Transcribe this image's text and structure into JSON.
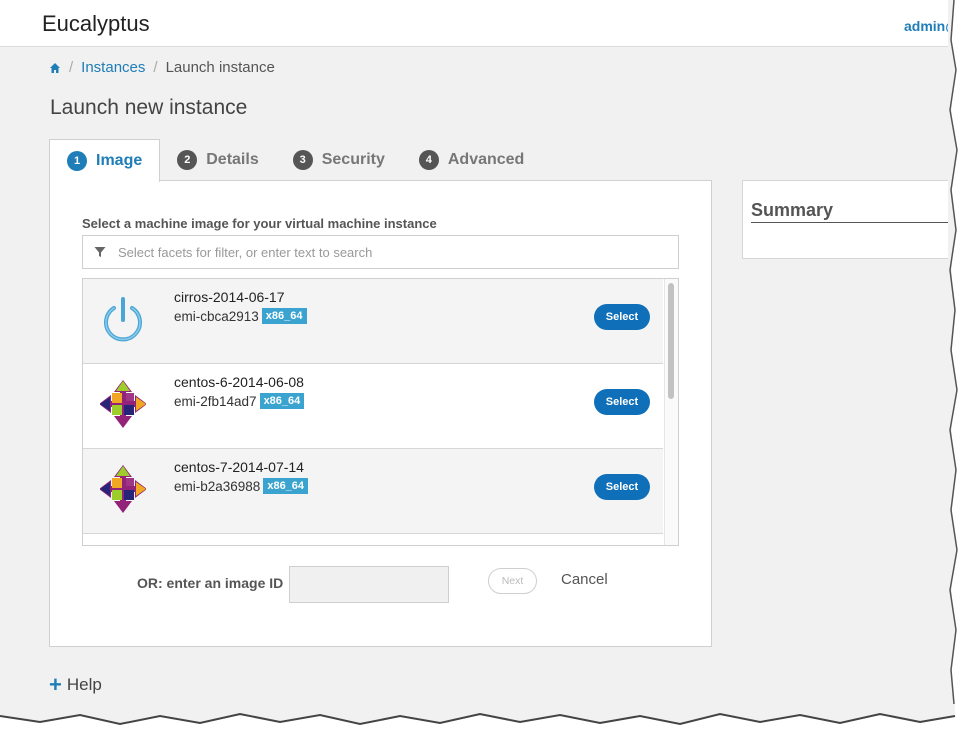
{
  "app": {
    "title": "Eucalyptus",
    "user": "admin@"
  },
  "breadcrumb": {
    "link": "Instances",
    "separator": "/",
    "current": "Launch instance"
  },
  "page": {
    "title": "Launch new instance"
  },
  "tabs": [
    {
      "num": "1",
      "label": "Image",
      "active": true
    },
    {
      "num": "2",
      "label": "Details",
      "active": false
    },
    {
      "num": "3",
      "label": "Security",
      "active": false
    },
    {
      "num": "4",
      "label": "Advanced",
      "active": false
    }
  ],
  "image_step": {
    "instruction": "Select a machine image for your virtual machine instance",
    "search_placeholder": "Select facets for filter, or enter text to search",
    "images": [
      {
        "name": "cirros-2014-06-17",
        "id": "emi-cbca2913",
        "arch": "x86_64",
        "icon": "power-icon",
        "button": "Select"
      },
      {
        "name": "centos-6-2014-06-08",
        "id": "emi-2fb14ad7",
        "arch": "x86_64",
        "icon": "centos-icon",
        "button": "Select"
      },
      {
        "name": "centos-7-2014-07-14",
        "id": "emi-b2a36988",
        "arch": "x86_64",
        "icon": "centos-icon",
        "button": "Select"
      }
    ],
    "or_label": "OR: enter an image ID",
    "next_label": "Next",
    "cancel_label": "Cancel"
  },
  "summary": {
    "title": "Summary"
  },
  "help": {
    "label": "Help"
  },
  "colors": {
    "accent": "#1f7db8",
    "button": "#0f6fb8",
    "badge": "#3aa3cf"
  }
}
